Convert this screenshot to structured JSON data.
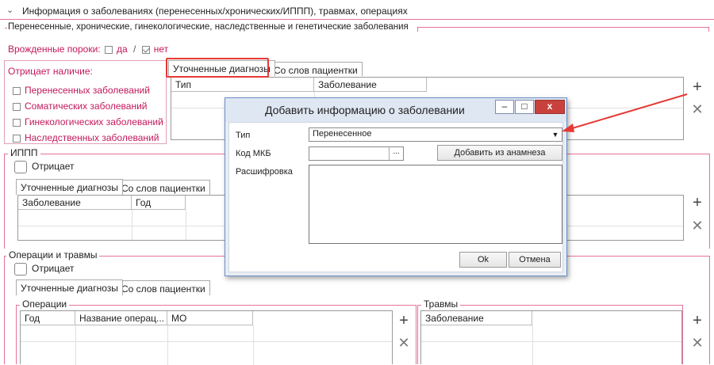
{
  "section_header": {
    "chevron": "chevron-down-icon",
    "title": "Информация о заболеваниях (перенесенных/хронических/ИППП), травмах, операциях"
  },
  "diseases_group": {
    "title": "Перенесенные, хронические, гинекологические, наследственные и генетические заболевания",
    "congenital_label": "Врожденные пороки:",
    "yes_label": "да",
    "separator": "/",
    "no_label": "нет",
    "denies_title": "Отрицает наличие:",
    "denies_items": [
      "Перенесенных заболеваний",
      "Соматических заболеваний",
      "Гинекологических заболеваний",
      "Наследственных заболеваний"
    ],
    "tabs": [
      "Уточненные диагнозы",
      "Со слов пациентки"
    ],
    "grid_columns": [
      "Тип",
      "Заболевание"
    ]
  },
  "ippp_group": {
    "title": "ИППП",
    "denies_label": "Отрицает",
    "tabs": [
      "Уточненные диагнозы",
      "Со слов пациентки"
    ],
    "grid_columns": [
      "Заболевание",
      "Год"
    ]
  },
  "operations_group": {
    "title": "Операции и травмы",
    "denies_label": "Отрицает",
    "tabs": [
      "Уточненные диагнозы",
      "Со слов пациентки"
    ],
    "operations_title": "Операции",
    "operations_columns": [
      "Год",
      "Название операц...",
      "МО"
    ],
    "injuries_title": "Травмы",
    "injuries_columns": [
      "Заболевание"
    ]
  },
  "icons": {
    "add": "+",
    "remove": "✕"
  },
  "dialog": {
    "title": "Добавить информацию о заболевании",
    "minimize": "–",
    "maximize": "□",
    "close": "x",
    "type_label": "Тип",
    "type_value": "Перенесенное",
    "mkb_label": "Код МКБ",
    "mkb_value": "",
    "browse_button": "...",
    "add_from_anamnesis": "Добавить из анамнеза",
    "decoding_label": "Расшифровка",
    "decoding_value": "",
    "ok_button": "Ok",
    "cancel_button": "Отмена"
  },
  "colors": {
    "accent_pink": "#e57399",
    "annotation_red": "#e53935",
    "dialog_border": "#6b8fc7"
  }
}
